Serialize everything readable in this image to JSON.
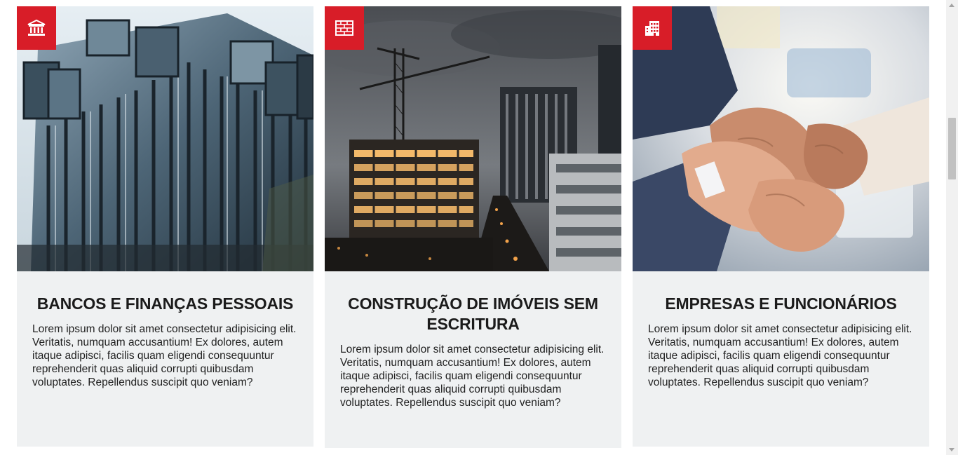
{
  "cards": [
    {
      "title": "BANCOS E FINANÇAS PESSOAIS",
      "text": "Lorem ipsum dolor sit amet consectetur adipisicing elit. Veritatis, numquam accusantium! Ex dolores, autem itaque adipisci, facilis quam eligendi consequuntur reprehenderit quas aliquid corrupti quibusdam voluptates. Repellendus suscipit quo veniam?",
      "icon": "bank-icon",
      "image": "glass-office-building"
    },
    {
      "title": "CONSTRUÇÃO DE IMÓVEIS SEM ESCRITURA",
      "text": "Lorem ipsum dolor sit amet consectetur adipisicing elit. Veritatis, numquam accusantium! Ex dolores, autem itaque adipisci, facilis quam eligendi consequuntur reprehenderit quas aliquid corrupti quibusdam voluptates. Repellendus suscipit quo veniam?",
      "icon": "brick-wall-icon",
      "image": "construction-site-at-night"
    },
    {
      "title": "EMPRESAS E FUNCIONÁRIOS",
      "text": "Lorem ipsum dolor sit amet consectetur adipisicing elit. Veritatis, numquam accusantium! Ex dolores, autem itaque adipisci, facilis quam eligendi consequuntur reprehenderit quas aliquid corrupti quibusdam voluptates. Repellendus suscipit quo veniam?",
      "icon": "building-icon",
      "image": "stacked-hands-teamwork"
    }
  ],
  "colors": {
    "accent": "#d81d28",
    "card_background": "#eff1f2",
    "text": "#1b1b1b"
  }
}
